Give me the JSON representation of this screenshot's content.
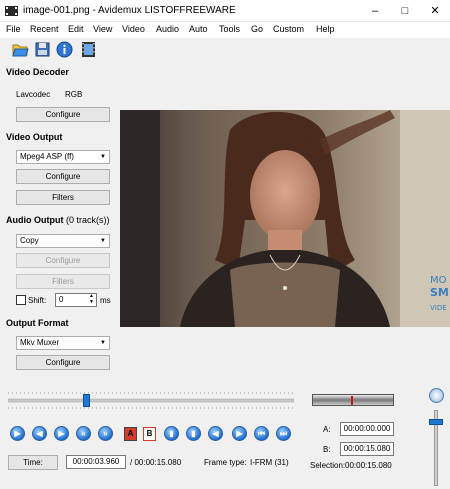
{
  "window": {
    "title": "image-001.png - Avidemux",
    "watermark": "LISTOFFREEWARE",
    "minimize": "–",
    "maximize": "□",
    "close": "✕"
  },
  "menu": [
    "File",
    "Recent",
    "Edit",
    "View",
    "Video",
    "Audio",
    "Auto",
    "Tools",
    "Go",
    "Custom",
    "Help"
  ],
  "toolbar": {
    "icons": [
      "open-folder-icon",
      "save-disk-icon",
      "info-icon",
      "film-icon"
    ]
  },
  "video_decoder": {
    "title": "Video Decoder",
    "codec_label": "Lavcodec",
    "codec_value": "RGB",
    "configure": "Configure"
  },
  "video_output": {
    "title": "Video Output",
    "codec": "Mpeg4 ASP (ff)",
    "configure": "Configure",
    "filters": "Filters"
  },
  "audio_output": {
    "title": "Audio Output",
    "tracks": "(0 track(s))",
    "codec": "Copy",
    "configure": "Configure",
    "filters": "Filters",
    "shift_label": "Shift:",
    "shift_value": "0",
    "shift_unit": "ms"
  },
  "output_format": {
    "title": "Output Format",
    "muxer": "Mkv Muxer",
    "configure": "Configure"
  },
  "overlay": {
    "text1": "MO",
    "text2": "SM",
    "text3": "VIDE"
  },
  "playback": {
    "marker_a": "A",
    "marker_b": "B",
    "slider_position": 0.27,
    "volume_level": 0.88
  },
  "status": {
    "time_button": "Time:",
    "current_time": "00:00:03.960",
    "total_time": "/ 00:00:15.080",
    "frame_type_label": "Frame type:",
    "frame_type_value": "I-FRM (31)"
  },
  "selection": {
    "a_label": "A:",
    "a_value": "00:00:00.000",
    "b_label": "B:",
    "b_value": "00:00:15.080",
    "selection_label": "Selection:",
    "selection_value": "00:00:15.080"
  }
}
